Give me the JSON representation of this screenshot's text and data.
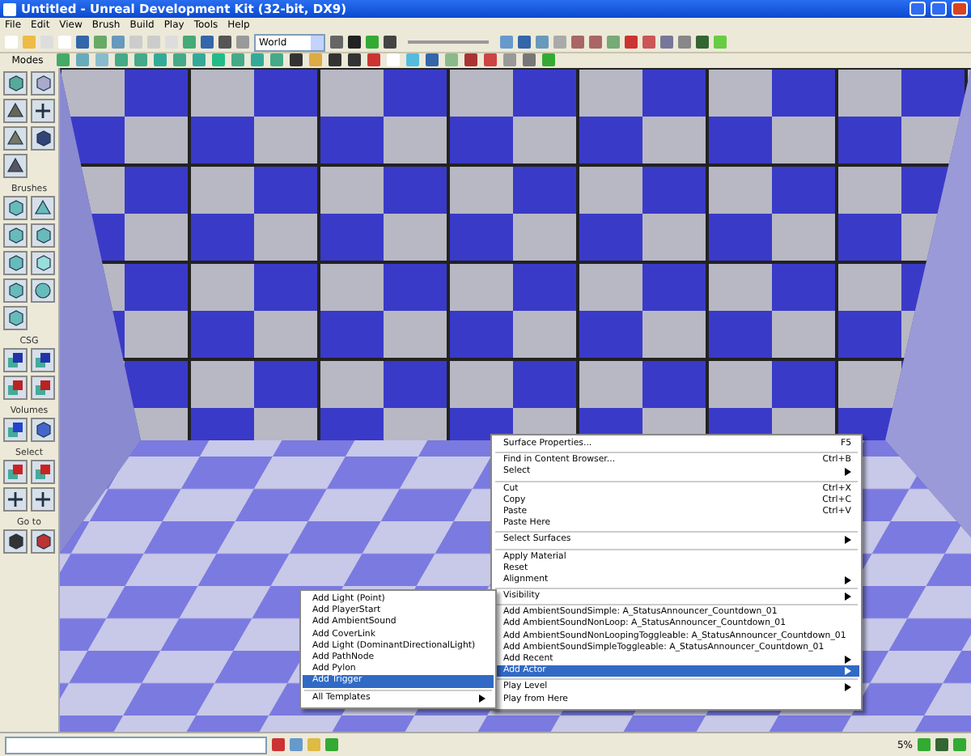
{
  "window": {
    "title": "Untitled - Unreal Development Kit (32-bit, DX9)"
  },
  "menu_bar": [
    "File",
    "Edit",
    "View",
    "Brush",
    "Build",
    "Play",
    "Tools",
    "Help"
  ],
  "toolbar": {
    "coordinate_system": "World"
  },
  "modes_bar": {
    "label": "Modes"
  },
  "tool_panel": {
    "sections": [
      {
        "title": "Brushes"
      },
      {
        "title": "CSG"
      },
      {
        "title": "Volumes"
      },
      {
        "title": "Select"
      },
      {
        "title": "Go to"
      }
    ]
  },
  "context_menu": {
    "items": [
      {
        "kind": "item",
        "label": "Surface Properties...",
        "shortcut": "F5",
        "submenu": false,
        "selected": false
      },
      {
        "kind": "separator"
      },
      {
        "kind": "item",
        "label": "Find in Content Browser...",
        "shortcut": "Ctrl+B",
        "submenu": false,
        "selected": false
      },
      {
        "kind": "item",
        "label": "Select",
        "submenu": true,
        "selected": false
      },
      {
        "kind": "separator"
      },
      {
        "kind": "item",
        "label": "Cut",
        "shortcut": "Ctrl+X",
        "submenu": false,
        "selected": false
      },
      {
        "kind": "item",
        "label": "Copy",
        "shortcut": "Ctrl+C",
        "submenu": false,
        "selected": false
      },
      {
        "kind": "item",
        "label": "Paste",
        "shortcut": "Ctrl+V",
        "submenu": false,
        "selected": false
      },
      {
        "kind": "item",
        "label": "Paste Here",
        "submenu": false,
        "selected": false
      },
      {
        "kind": "separator"
      },
      {
        "kind": "item",
        "label": "Select Surfaces",
        "submenu": true,
        "selected": false
      },
      {
        "kind": "separator"
      },
      {
        "kind": "item",
        "label": "Apply Material",
        "submenu": false,
        "selected": false
      },
      {
        "kind": "item",
        "label": "Reset",
        "submenu": false,
        "selected": false
      },
      {
        "kind": "item",
        "label": "Alignment",
        "submenu": true,
        "selected": false
      },
      {
        "kind": "separator"
      },
      {
        "kind": "item",
        "label": "Visibility",
        "submenu": true,
        "selected": false
      },
      {
        "kind": "separator"
      },
      {
        "kind": "item",
        "label": "Add AmbientSoundSimple: A_StatusAnnouncer_Countdown_01",
        "submenu": false,
        "selected": false
      },
      {
        "kind": "item",
        "label": "Add AmbientSoundNonLoop: A_StatusAnnouncer_Countdown_01",
        "submenu": false,
        "selected": false
      },
      {
        "kind": "item",
        "label": "Add AmbientSoundNonLoopingToggleable: A_StatusAnnouncer_Countdown_01",
        "submenu": false,
        "selected": false
      },
      {
        "kind": "item",
        "label": "Add AmbientSoundSimpleToggleable: A_StatusAnnouncer_Countdown_01",
        "submenu": false,
        "selected": false
      },
      {
        "kind": "item",
        "label": "Add Recent",
        "submenu": true,
        "selected": false
      },
      {
        "kind": "item",
        "label": "Add Actor",
        "submenu": true,
        "selected": true
      },
      {
        "kind": "separator"
      },
      {
        "kind": "item",
        "label": "Play Level",
        "submenu": true,
        "selected": false
      },
      {
        "kind": "item",
        "label": "Play from Here",
        "submenu": false,
        "selected": false
      }
    ]
  },
  "submenu": {
    "items": [
      {
        "kind": "item",
        "label": "Add Light (Point)",
        "submenu": false,
        "selected": false
      },
      {
        "kind": "item",
        "label": "Add PlayerStart",
        "submenu": false,
        "selected": false
      },
      {
        "kind": "item",
        "label": "Add AmbientSound",
        "submenu": false,
        "selected": false
      },
      {
        "kind": "item",
        "label": "Add CoverLink",
        "submenu": false,
        "selected": false
      },
      {
        "kind": "item",
        "label": "Add Light (DominantDirectionalLight)",
        "submenu": false,
        "selected": false
      },
      {
        "kind": "item",
        "label": "Add PathNode",
        "submenu": false,
        "selected": false
      },
      {
        "kind": "item",
        "label": "Add Pylon",
        "submenu": false,
        "selected": false
      },
      {
        "kind": "item",
        "label": "Add Trigger",
        "submenu": false,
        "selected": true
      },
      {
        "kind": "separator"
      },
      {
        "kind": "item",
        "label": "All Templates",
        "submenu": true,
        "selected": false
      }
    ]
  },
  "status_bar": {
    "zoom": "5%"
  }
}
